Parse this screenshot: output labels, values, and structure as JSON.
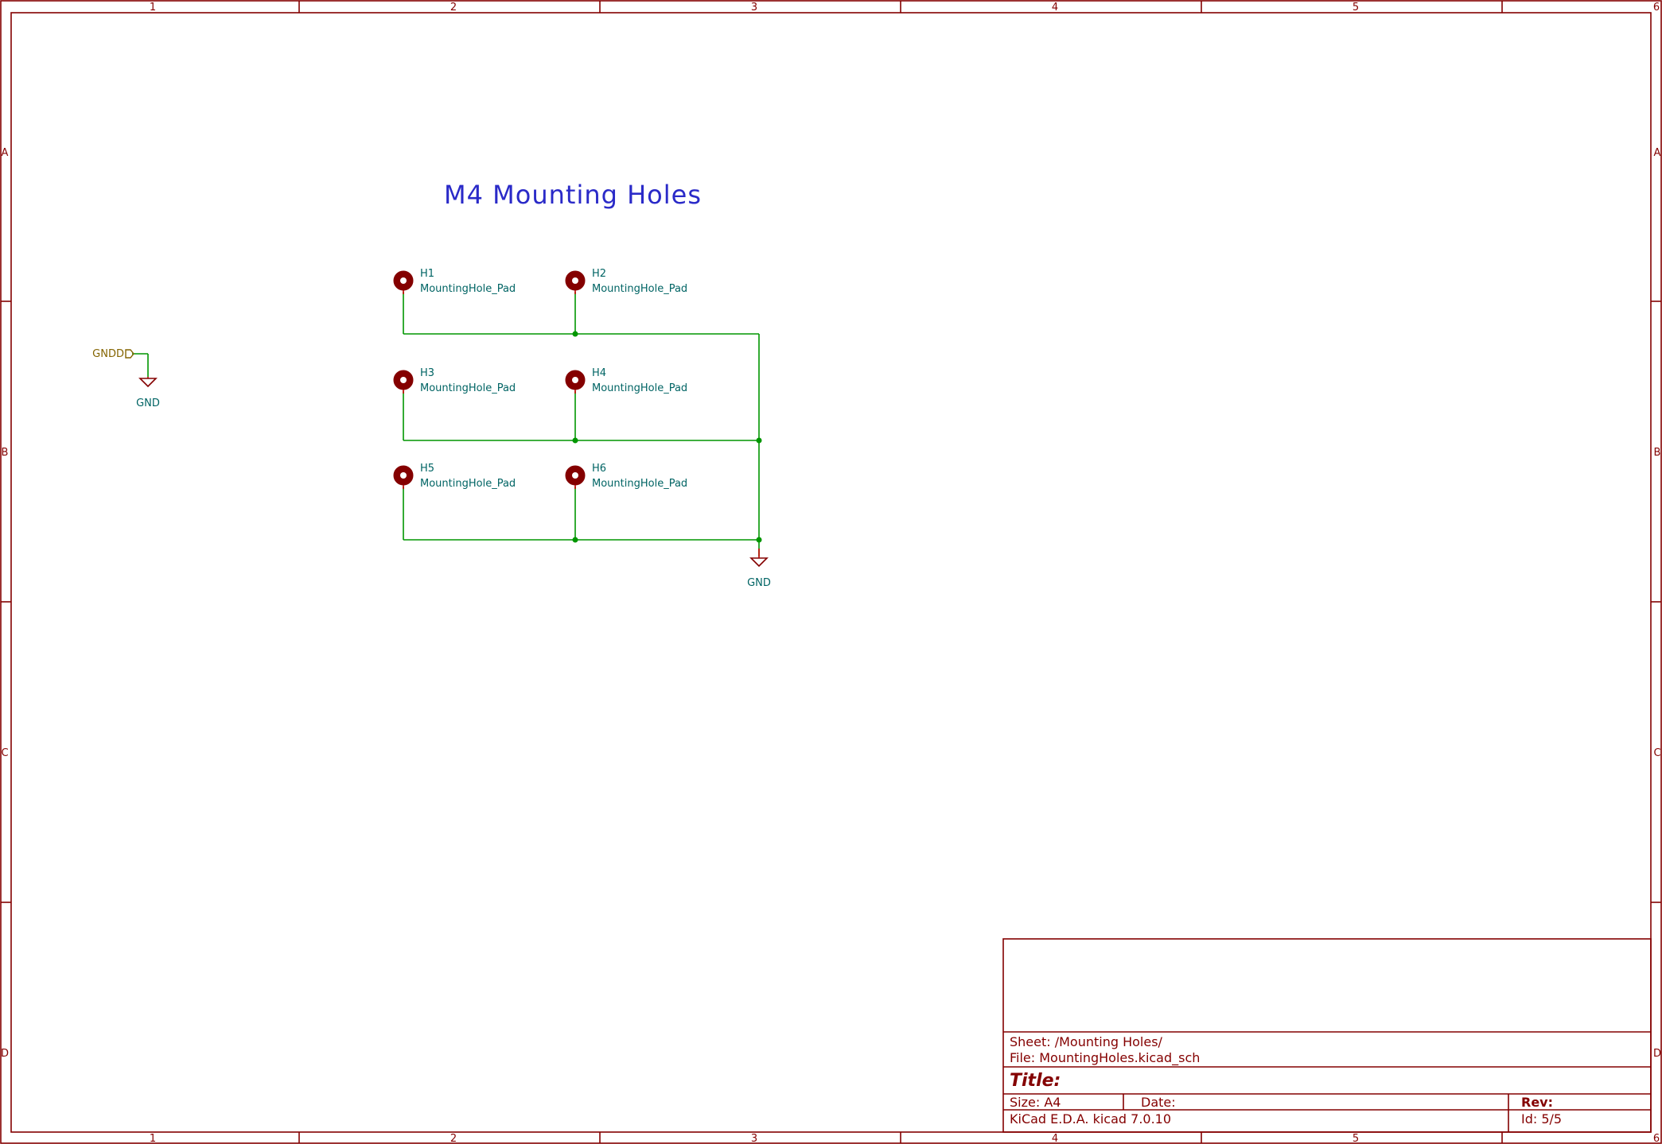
{
  "frame": {
    "columns": [
      "1",
      "2",
      "3",
      "4",
      "5",
      "6"
    ],
    "rows": [
      "A",
      "B",
      "C",
      "D"
    ]
  },
  "schematic": {
    "heading": "M4 Mounting Holes",
    "holes": [
      {
        "ref": "H1",
        "value": "MountingHole_Pad"
      },
      {
        "ref": "H2",
        "value": "MountingHole_Pad"
      },
      {
        "ref": "H3",
        "value": "MountingHole_Pad"
      },
      {
        "ref": "H4",
        "value": "MountingHole_Pad"
      },
      {
        "ref": "H5",
        "value": "MountingHole_Pad"
      },
      {
        "ref": "H6",
        "value": "MountingHole_Pad"
      }
    ],
    "gnd_symbol_label": "GND",
    "hier_label": "GNDD",
    "hier_gnd_label": "GND"
  },
  "title_block": {
    "sheet": "Sheet: /Mounting Holes/",
    "file": "File: MountingHoles.kicad_sch",
    "title": "Title:",
    "size": "Size: A4",
    "date": "Date:",
    "rev": "Rev:",
    "tool": "KiCad E.D.A.  kicad 7.0.10",
    "id": "Id: 5/5"
  },
  "colors": {
    "frame": "#840000",
    "wire": "#009600",
    "junction": "#009600",
    "heading": "#2a2ac8",
    "ref_text": "#006464",
    "symbol_body": "#840000",
    "hier_label": "#846400"
  }
}
